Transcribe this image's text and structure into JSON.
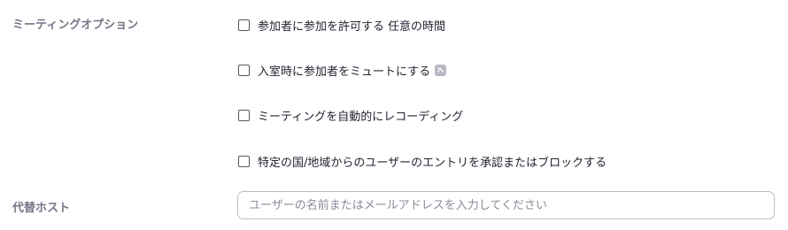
{
  "meeting_options": {
    "label": "ミーティングオプション",
    "options": [
      {
        "label": "参加者に参加を許可する",
        "extra": "任意の時間",
        "checked": false
      },
      {
        "label": "入室時に参加者をミュートにする",
        "icon": "info-badge-icon",
        "checked": false
      },
      {
        "label": "ミーティングを自動的にレコーディング",
        "checked": false
      },
      {
        "label": "特定の国/地域からのユーザーのエントリを承認またはブロックする",
        "checked": false
      }
    ]
  },
  "alternative_host": {
    "label": "代替ホスト",
    "value": "",
    "placeholder": "ユーザーの名前またはメールアドレスを入力してください"
  }
}
